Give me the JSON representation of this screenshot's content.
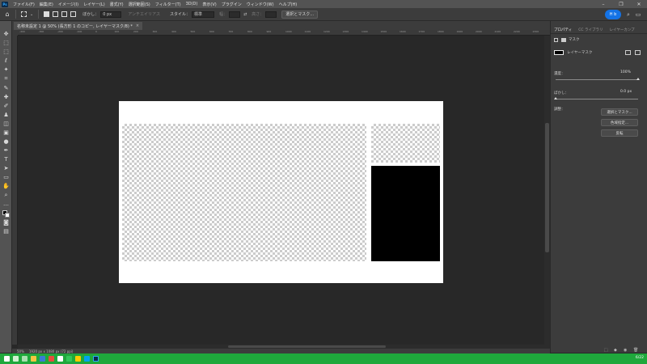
{
  "app": {
    "logo": "Ps",
    "accent_color": "#31a8ff"
  },
  "menu": {
    "items": [
      "ファイル(F)",
      "編集(E)",
      "イメージ(I)",
      "レイヤー(L)",
      "書式(Y)",
      "選択範囲(S)",
      "フィルター(T)",
      "3D(D)",
      "表示(V)",
      "プラグイン",
      "ウィンドウ(W)",
      "ヘルプ(H)"
    ],
    "window_controls": [
      "–",
      "❐",
      "✕"
    ]
  },
  "options_bar": {
    "feather_label": "ぼかし：",
    "feather_value": "0 px",
    "antialias_label": "アンチエイリアス",
    "style_label": "スタイル：",
    "style_value": "標準",
    "width_label": "幅：",
    "height_label": "高さ：",
    "select_mask_button": "選択とマスク...",
    "share_badge": "H b"
  },
  "document": {
    "tab_title": "名称未設定 1 @ 50% (長方形 1 のコピー, レイヤーマスク/8) *",
    "tab_close": "×",
    "zoom": "50%",
    "dimensions": "1920 px x 1080 px (72 ppi)"
  },
  "ruler": {
    "h_ticks": [
      "-400",
      "-300",
      "-200",
      "-100",
      "0",
      "100",
      "200",
      "300",
      "400",
      "500",
      "600",
      "700",
      "800",
      "900",
      "1000",
      "1100",
      "1200",
      "1300",
      "1400",
      "1500",
      "1600",
      "1700",
      "1800",
      "1900",
      "2000",
      "2100",
      "2200",
      "2300"
    ]
  },
  "properties_panel": {
    "tabs": [
      "プロパティ",
      "CC ライブラリ",
      "レイヤーカンプ"
    ],
    "active_tab": "プロパティ",
    "mask_header": "マスク",
    "layer_mask_label": "レイヤーマスク",
    "density_label": "濃度：",
    "density_value": "100%",
    "density_fraction": 1.0,
    "feather_label": "ぼかし：",
    "feather_value": "0.0 px",
    "feather_fraction": 0.0,
    "adjust_label": "調整：",
    "buttons": [
      "選択とマスク...",
      "色域指定...",
      "反転"
    ]
  },
  "taskbar": {
    "clock": "6/22",
    "color": "#1fa83c"
  }
}
